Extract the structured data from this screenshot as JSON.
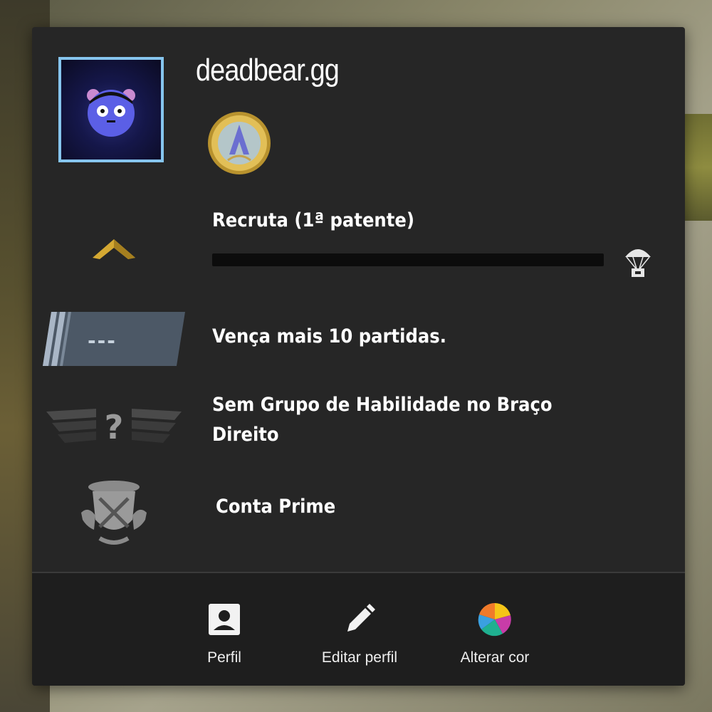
{
  "player": {
    "username": "deadbear.gg"
  },
  "rank": {
    "title": "Recruta (1ª patente)",
    "progress": 0
  },
  "competitive": {
    "rating_placeholder": "---",
    "message": "Vença mais 10 partidas."
  },
  "skill_group": {
    "text": "Sem Grupo de Habilidade no Braço Direito"
  },
  "prime": {
    "text": "Conta Prime"
  },
  "actions": {
    "profile_label": "Perfil",
    "edit_profile_label": "Editar perfil",
    "change_color_label": "Alterar cor"
  },
  "colors": {
    "panel": "#262626",
    "footer": "#1e1e1e",
    "avatar_border": "#86c5ee",
    "rank_gold": "#d4a832"
  },
  "icons": [
    "avatar-bear",
    "service-medal-icon",
    "rank-chevron-icon",
    "care-package-icon",
    "rating-badge-icon",
    "skill-group-icon",
    "prime-badge-icon",
    "profile-icon",
    "pencil-icon",
    "color-wheel-icon"
  ]
}
